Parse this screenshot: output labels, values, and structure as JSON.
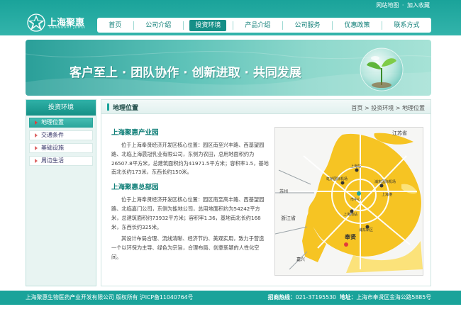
{
  "top_links": {
    "sitemap": "网站地图",
    "favorite": "加入收藏",
    "separator": "·"
  },
  "logo": {
    "name_cn": "上海聚惠",
    "name_en": "SHANGHAI JUHUI"
  },
  "nav": {
    "items": [
      {
        "label": "首页",
        "active": false
      },
      {
        "label": "公司介绍",
        "active": false
      },
      {
        "label": "投资环境",
        "active": true
      },
      {
        "label": "产品介绍",
        "active": false
      },
      {
        "label": "公司服务",
        "active": false
      },
      {
        "label": "优惠政策",
        "active": false
      },
      {
        "label": "联系方式",
        "active": false
      }
    ]
  },
  "banner": {
    "slogan": "客户至上 · 团队协作 · 创新进取 · 共同发展"
  },
  "sidebar": {
    "title": "投资环境",
    "items": [
      {
        "label": "地理位置",
        "active": true
      },
      {
        "label": "交通条件",
        "active": false
      },
      {
        "label": "基础设施",
        "active": false
      },
      {
        "label": "周边生活",
        "active": false
      }
    ]
  },
  "content": {
    "title": "地理位置",
    "breadcrumb": "首页 > 投资环境 > 地理位置",
    "sections": [
      {
        "title": "上海聚惠产业园",
        "paragraph": "位于上海奉贤经济开发区核心位置：园区南至兴丰路、西基望园路、北临上海晨冠乳业有限公司，东侧为农田，总用地面积约为26507.8平方米，总建筑面积约为41971.5平方米；容积率1.5，基地南北长约173米，东西长约150米。"
      },
      {
        "title": "上海聚惠总部园",
        "paragraph": "位于上海奉贤经济开发区核心位置：园区南至高丰路、西基望园路、北临嘉门公司，东侧为能地公司，总用地面积约为54242平方米，总建筑面积约73932平方米；容积率1.36，基地南北长约168米，东西长约325米。"
      }
    ],
    "closing": "其设计布局合理、流线清晰、经济节约、美观实用，致力于营造一个以环保为主导、绿色为宗旨，合理布局、创意新颖的人性化空间。"
  },
  "map": {
    "labels": {
      "jiangsu": "江苏省",
      "zhejiang": "浙江省",
      "suzhou": "苏州",
      "jiaxing": "嘉兴",
      "fengxian": "奉贤",
      "city_center": "市中心",
      "shanghai": "上海港",
      "hongqiao": "虹桥国际机场",
      "pudong": "浦东国际机场",
      "shanghai_south": "上海南站",
      "shanghai_station": "上海站",
      "pudong_area": "浦东新区"
    },
    "colors": {
      "land": "#f6c423",
      "land_light": "#fbe27a",
      "roads": "#ffffff",
      "water": "#f6f6f4"
    }
  },
  "footer": {
    "copyright": "上海聚惠生物医药产业开发有限公司 版权所有 沪ICP备11040764号",
    "hotline_label": "招商热线：",
    "hotline": "021-37195530",
    "address_label": "地址：",
    "address": "上海市奉贤区金海公路5885号"
  },
  "colors": {
    "brand": "#1aa39a",
    "brand_dark": "#107f78",
    "accent_red": "#e23b3b"
  }
}
